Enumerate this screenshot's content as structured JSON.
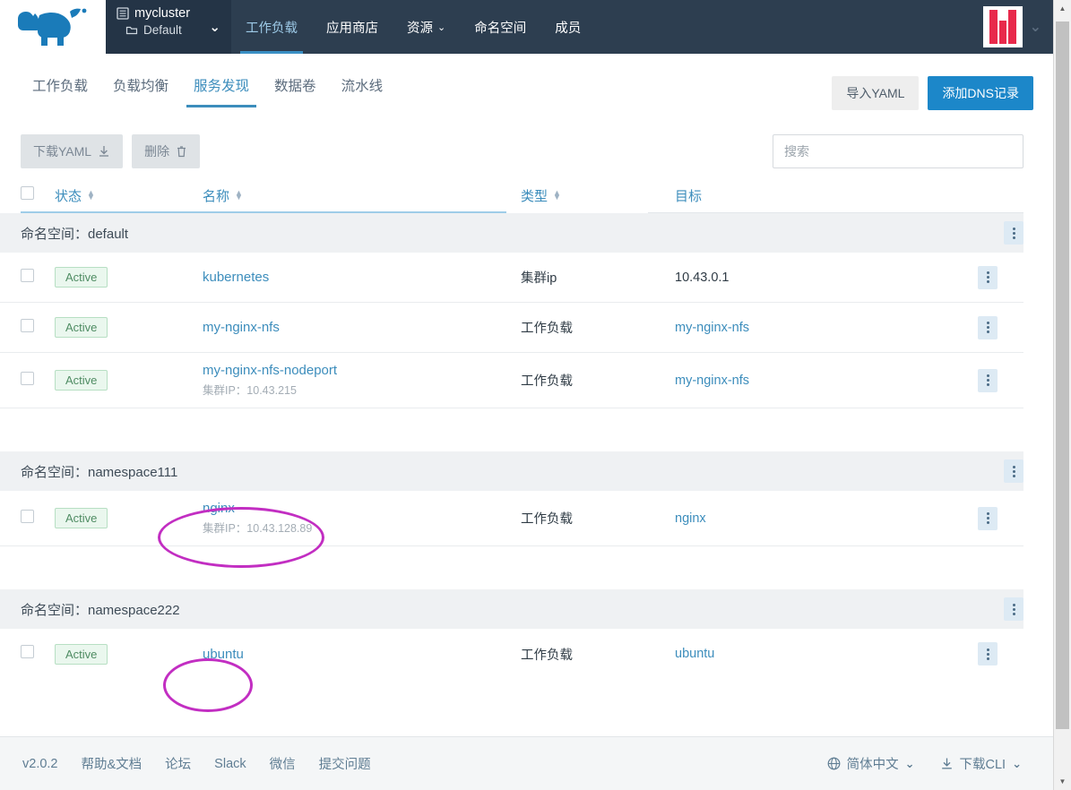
{
  "topbar": {
    "logo_name": "rancher-cow-logo",
    "cluster": {
      "name": "mycluster",
      "project": "Default",
      "caret": "⌄"
    },
    "nav": [
      {
        "label": "工作负载",
        "active": true,
        "caret": ""
      },
      {
        "label": "应用商店",
        "active": false,
        "caret": ""
      },
      {
        "label": "资源",
        "active": false,
        "caret": "⌄"
      },
      {
        "label": "命名空间",
        "active": false,
        "caret": ""
      },
      {
        "label": "成员",
        "active": false,
        "caret": ""
      }
    ],
    "avatar_caret": "⌄"
  },
  "tabs": [
    {
      "label": "工作负载",
      "active": false
    },
    {
      "label": "负载均衡",
      "active": false
    },
    {
      "label": "服务发现",
      "active": true
    },
    {
      "label": "数据卷",
      "active": false
    },
    {
      "label": "流水线",
      "active": false
    }
  ],
  "page_actions": {
    "import_yaml": "导入YAML",
    "add_dns": "添加DNS记录"
  },
  "toolbar": {
    "download_yaml": "下载YAML",
    "download_icon": "download-icon",
    "delete": "删除",
    "delete_icon": "trash-icon",
    "search_placeholder": "搜索",
    "search_value": ""
  },
  "table": {
    "headers": {
      "status": "状态",
      "name": "名称",
      "type": "类型",
      "target": "目标"
    },
    "groups": [
      {
        "label": "命名空间：default",
        "rows": [
          {
            "status": "Active",
            "name": "kubernetes",
            "sub": "",
            "type": "集群ip",
            "target": "10.43.0.1",
            "target_is_link": false
          },
          {
            "status": "Active",
            "name": "my-nginx-nfs",
            "sub": "",
            "type": "工作负载",
            "target": "my-nginx-nfs",
            "target_is_link": true
          },
          {
            "status": "Active",
            "name": "my-nginx-nfs-nodeport",
            "sub": "集群IP：10.43.215",
            "type": "工作负载",
            "target": "my-nginx-nfs",
            "target_is_link": true
          }
        ]
      },
      {
        "label": "命名空间：namespace111",
        "rows": [
          {
            "status": "Active",
            "name": "nginx",
            "sub": "集群IP：10.43.128.89",
            "type": "工作负载",
            "target": "nginx",
            "target_is_link": true
          }
        ]
      },
      {
        "label": "命名空间：namespace222",
        "rows": [
          {
            "status": "Active",
            "name": "ubuntu",
            "sub": "",
            "type": "工作负载",
            "target": "ubuntu",
            "target_is_link": true
          }
        ]
      }
    ]
  },
  "footer": {
    "version": "v2.0.2",
    "links": [
      "帮助&文档",
      "论坛",
      "Slack",
      "微信",
      "提交问题"
    ],
    "language": {
      "icon": "globe-icon",
      "label": "简体中文",
      "caret": "⌄"
    },
    "cli": {
      "icon": "download-icon",
      "label": "下载CLI",
      "caret": "⌄"
    }
  },
  "annotations": {
    "color": "#c22ec2",
    "shapes": [
      {
        "name": "nginx-highlight-ellipse"
      },
      {
        "name": "ubuntu-highlight-ellipse"
      }
    ]
  },
  "scrollbar": {
    "up": "▲",
    "down": "▼"
  }
}
